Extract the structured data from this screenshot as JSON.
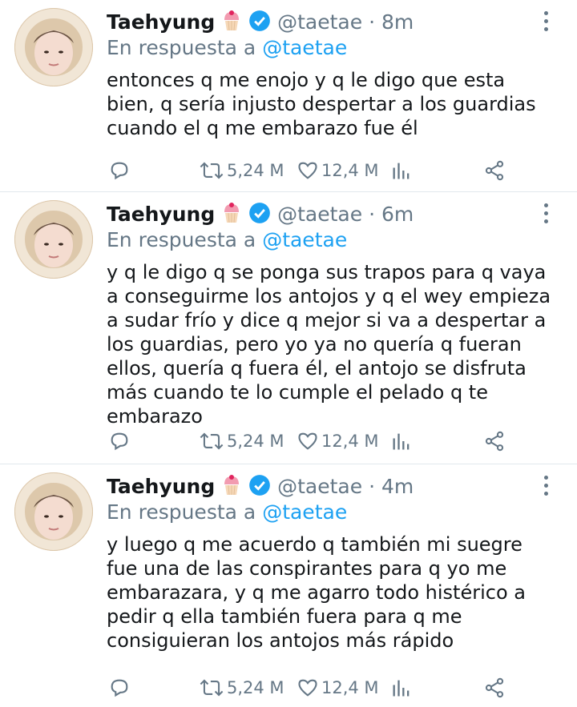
{
  "tweets": [
    {
      "name": "Taehyung",
      "handle": "@taetae",
      "time": "8m",
      "reply_prefix": "En respuesta a",
      "reply_to": "@taetae",
      "text": "entonces q me enojo y q le digo que esta bien, q sería injusto despertar a los guardias cuando el q me embarazo fue él",
      "retweets": "5,24 M",
      "likes": "12,4 M"
    },
    {
      "name": "Taehyung",
      "handle": "@taetae",
      "time": "6m",
      "reply_prefix": "En respuesta a",
      "reply_to": "@taetae",
      "text": "y q le digo q se ponga sus trapos para q vaya a conseguirme los antojos y q el wey empieza a sudar frío y dice q mejor si va a despertar a los guardias, pero yo ya no quería q fueran ellos, quería q fuera él, el antojo se disfruta más cuando te lo cumple el pelado q te embarazo",
      "retweets": "5,24 M",
      "likes": "12,4 M"
    },
    {
      "name": "Taehyung",
      "handle": "@taetae",
      "time": "4m",
      "reply_prefix": "En respuesta a",
      "reply_to": "@taetae",
      "text": "y luego q me acuerdo q también mi suegre fue una de las conspirantes para q yo me embarazara, y q me agarro todo histérico a pedir q ella también fuera para q me consiguieran los antojos más rápido",
      "retweets": "5,24 M",
      "likes": "12,4 M"
    }
  ],
  "colors": {
    "text": "#14171a",
    "secondary": "#657786",
    "link": "#1da1f2",
    "divider": "#e1e8ed"
  },
  "icons": [
    "cupcake-icon",
    "verified-badge-icon",
    "more-options-icon",
    "reply-icon",
    "retweet-icon",
    "like-icon",
    "stats-icon",
    "share-icon"
  ]
}
